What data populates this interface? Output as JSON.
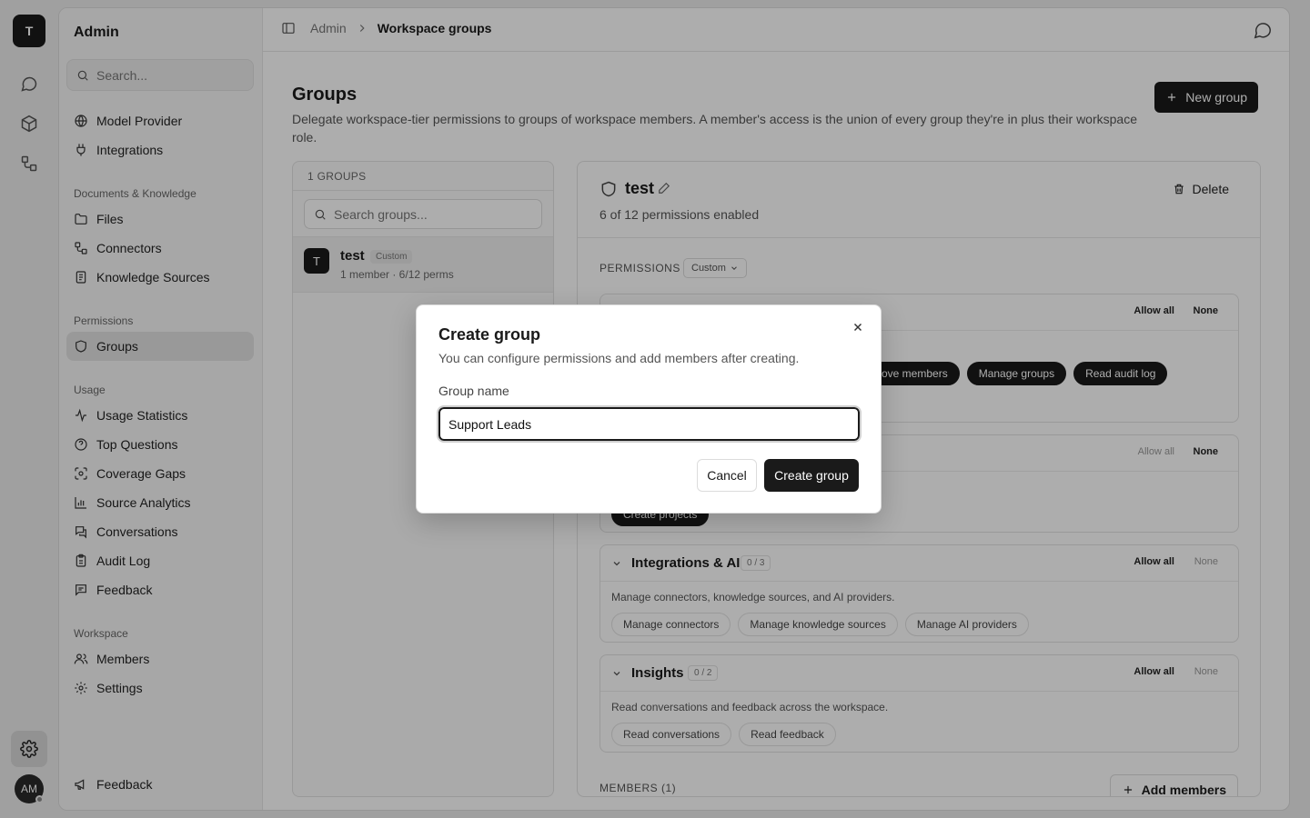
{
  "rail": {
    "workspace_initial": "T",
    "user_initials": "AM"
  },
  "sidebar": {
    "title": "Admin",
    "search_placeholder": "Search...",
    "top_items": [
      {
        "label": "Model Provider",
        "icon": "globe-icon"
      },
      {
        "label": "Integrations",
        "icon": "plug-icon"
      }
    ],
    "sections": [
      {
        "title": "Documents & Knowledge",
        "items": [
          {
            "label": "Files",
            "icon": "folder-icon"
          },
          {
            "label": "Connectors",
            "icon": "connector-icon"
          },
          {
            "label": "Knowledge Sources",
            "icon": "book-icon"
          }
        ]
      },
      {
        "title": "Permissions",
        "items": [
          {
            "label": "Groups",
            "icon": "shield-icon",
            "active": true
          }
        ]
      },
      {
        "title": "Usage",
        "items": [
          {
            "label": "Usage Statistics",
            "icon": "activity-icon"
          },
          {
            "label": "Top Questions",
            "icon": "question-icon"
          },
          {
            "label": "Coverage Gaps",
            "icon": "scan-icon"
          },
          {
            "label": "Source Analytics",
            "icon": "bar-chart-icon"
          },
          {
            "label": "Conversations",
            "icon": "chat-icon"
          },
          {
            "label": "Audit Log",
            "icon": "clipboard-icon"
          },
          {
            "label": "Feedback",
            "icon": "message-icon"
          }
        ]
      },
      {
        "title": "Workspace",
        "items": [
          {
            "label": "Members",
            "icon": "users-icon"
          },
          {
            "label": "Settings",
            "icon": "gear-icon"
          }
        ]
      }
    ],
    "footer_feedback": "Feedback"
  },
  "breadcrumb": {
    "parent": "Admin",
    "current": "Workspace groups"
  },
  "page": {
    "title": "Groups",
    "description": "Delegate workspace-tier permissions to groups of workspace members. A member's access is the union of every group they're in plus their workspace role.",
    "new_group_label": "New group"
  },
  "groups_list": {
    "header": "1 GROUPS",
    "search_placeholder": "Search groups...",
    "items": [
      {
        "initial": "T",
        "name": "test",
        "badge": "Custom",
        "meta": "1 member · 6/12 perms"
      }
    ]
  },
  "detail": {
    "name": "test",
    "summary": "6 of 12 permissions enabled",
    "delete_label": "Delete",
    "permissions_label": "PERMISSIONS",
    "preset": "Custom",
    "cards": [
      {
        "title": "",
        "count": "",
        "description": "",
        "allow_all": "Allow all",
        "none": "None",
        "chips": [
          {
            "label": "ove members",
            "on": true
          },
          {
            "label": "Manage groups",
            "on": true
          },
          {
            "label": "Read audit log",
            "on": true
          }
        ]
      },
      {
        "title": "",
        "count": "",
        "description": "",
        "allow_all": "Allow all",
        "none": "None",
        "chips": [
          {
            "label": "Create projects",
            "on": true
          }
        ]
      },
      {
        "title": "Integrations & AI",
        "count": "0 / 3",
        "description": "Manage connectors, knowledge sources, and AI providers.",
        "allow_all": "Allow all",
        "none": "None",
        "chips": [
          {
            "label": "Manage connectors",
            "on": false
          },
          {
            "label": "Manage knowledge sources",
            "on": false
          },
          {
            "label": "Manage AI providers",
            "on": false
          }
        ]
      },
      {
        "title": "Insights",
        "count": "0 / 2",
        "description": "Read conversations and feedback across the workspace.",
        "allow_all": "Allow all",
        "none": "None",
        "chips": [
          {
            "label": "Read conversations",
            "on": false
          },
          {
            "label": "Read feedback",
            "on": false
          }
        ]
      }
    ],
    "members_label": "MEMBERS (1)",
    "add_members_label": "Add members"
  },
  "modal": {
    "title": "Create group",
    "subtitle": "You can configure permissions and add members after creating.",
    "field_label": "Group name",
    "field_value": "Support Leads",
    "cancel_label": "Cancel",
    "create_label": "Create group"
  }
}
